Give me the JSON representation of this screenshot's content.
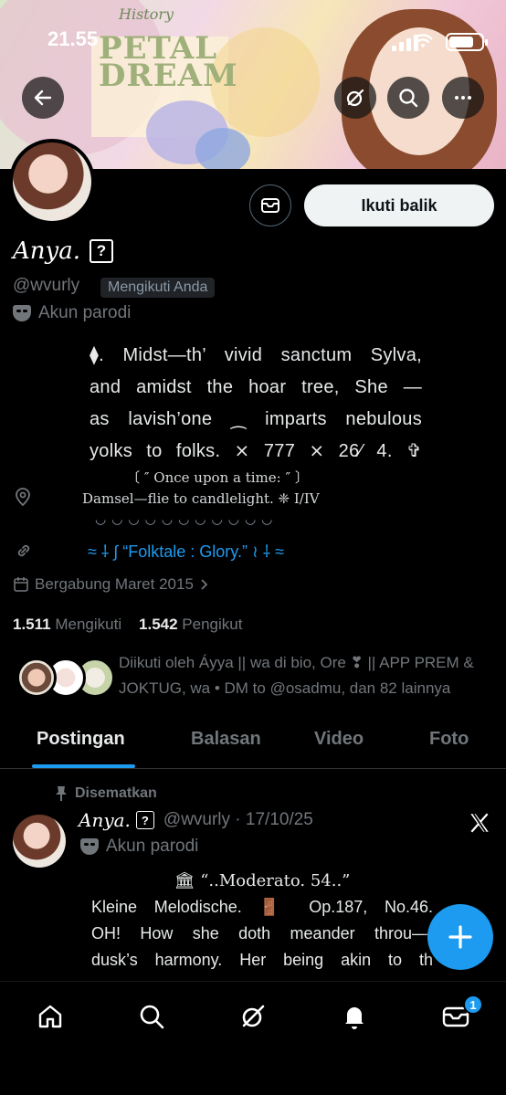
{
  "status_bar": {
    "time": "21.55"
  },
  "banner": {
    "line1": "PETAL",
    "line2": "DREAM",
    "tag": "History"
  },
  "profile": {
    "display_name": "Anya.",
    "name_box_glyph": "?",
    "handle": "@wvurly",
    "follows_you": "Mengikuti Anda",
    "parody_label": "Akun parodi",
    "follow_back_label": "Ikuti balik",
    "bio_lines": [
      "⧫. Midst—th’ vivid sanctum Sylva,",
      "and amidst the hoar tree, She —",
      "as lavish’one ⁔ imparts nebulous",
      "yolks to folks. ⨯ 777 ⨯ 26⁄ 4. ✞"
    ],
    "location_line1": "〔 ″ Once upon a time: ″ 〕",
    "location_line2": "Damsel—flie to candlelight. ❈ I/IV",
    "dots_line": "◡◡◡◡◡◡◡◡◡◡◡",
    "link": "≈ ⸸ ∫ “Folktale : Glory.” ≀ ⸸ ≈",
    "joined": "Bergabung Maret 2015",
    "following_count": "1.511",
    "following_label": "Mengikuti",
    "followers_count": "1.542",
    "followers_label": "Pengikut",
    "followed_by": "Diikuti oleh Áyya || wa di bio, Ore ❣ || APP PREM & JOKTUG, wa • DM to @osadmu, dan 82 lainnya"
  },
  "tabs": [
    {
      "label": "Postingan",
      "active": true
    },
    {
      "label": "Balasan",
      "active": false
    },
    {
      "label": "Video",
      "active": false
    },
    {
      "label": "Foto",
      "active": false
    }
  ],
  "post": {
    "pinned_label": "Disematkan",
    "author": "Anya.",
    "handle_time": "@wvurly · 17/10/25",
    "parody_label": "Akun parodi",
    "lines": [
      "🏛 “..Moderato. 54..”",
      "Kleine Melodische. 🚪 Op.187, No.46.",
      "OH! How she doth meander throu—t",
      "dusk’s harmony. Her being akin to th"
    ]
  },
  "bottom_nav": {
    "items": [
      "home-icon",
      "search-icon",
      "grok-icon",
      "notifications-icon",
      "messages-icon"
    ],
    "messages_badge": "1"
  },
  "colors": {
    "accent": "#1d9bf0",
    "background": "#000000",
    "muted": "#71767b"
  }
}
